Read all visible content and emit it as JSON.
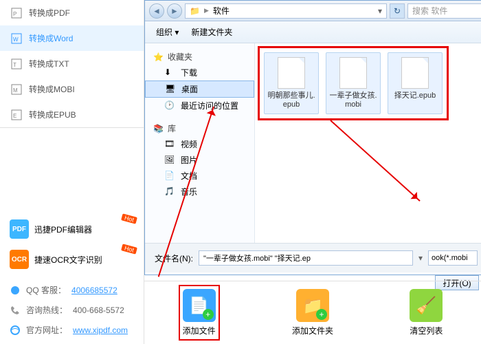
{
  "sidebar": {
    "items": [
      {
        "label": "转换成PDF"
      },
      {
        "label": "转换成Word"
      },
      {
        "label": "转换成TXT"
      },
      {
        "label": "转换成MOBI"
      },
      {
        "label": "转换成EPUB"
      }
    ],
    "promos": [
      {
        "label": "迅捷PDF编辑器",
        "badge": "Hot",
        "icon": "PDF"
      },
      {
        "label": "捷速OCR文字识别",
        "badge": "Hot",
        "icon": "OCR"
      }
    ],
    "contacts": {
      "qq_label": "QQ 客服：",
      "qq_value": "4006685572",
      "phone_label": "咨询热线：",
      "phone_value": "400-668-5572",
      "site_label": "官方网址：",
      "site_value": "www.xjpdf.com"
    }
  },
  "dialog": {
    "breadcrumb": {
      "root": "▸",
      "folder_icon": "📁",
      "folder": "软件"
    },
    "search_placeholder": "搜索 软件",
    "toolbar": {
      "organize": "组织 ▾",
      "newfolder": "新建文件夹"
    },
    "tree": {
      "fav_label": "收藏夹",
      "fav_items": [
        {
          "label": "下载"
        },
        {
          "label": "桌面"
        },
        {
          "label": "最近访问的位置"
        }
      ],
      "lib_label": "库",
      "lib_items": [
        {
          "label": "视频"
        },
        {
          "label": "图片"
        },
        {
          "label": "文档"
        },
        {
          "label": "音乐"
        }
      ]
    },
    "files": [
      {
        "name": "明朝那些事儿.epub"
      },
      {
        "name": "一辈子做女孩.mobi"
      },
      {
        "name": "择天记.epub"
      }
    ],
    "filename_label": "文件名(N):",
    "filename_value": "\"一辈子做女孩.mobi\" \"择天记.ep",
    "filter_value": "ook(*.mobi",
    "open_label": "打开(O)"
  },
  "actions": {
    "add_file": "添加文件",
    "add_folder": "添加文件夹",
    "clear_list": "清空列表"
  }
}
